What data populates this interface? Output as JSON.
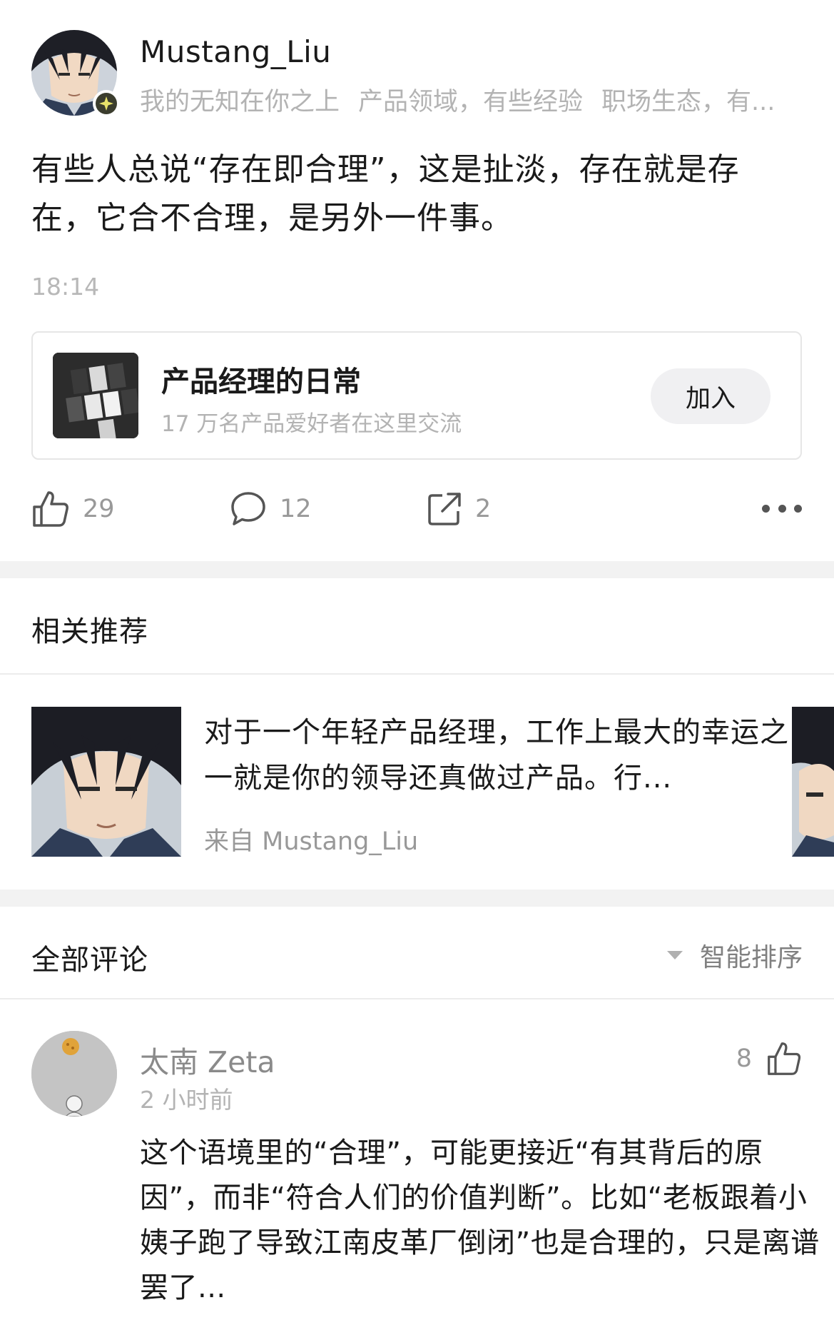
{
  "post": {
    "author": "Mustang_Liu",
    "tags": [
      "我的无知在你之上",
      "产品领域，有些经验",
      "职场生态，有..."
    ],
    "text": "有些人总说“存在即合理”，这是扯淡，存在就是存在，它合不合理，是另外一件事。",
    "time": "18:14"
  },
  "group": {
    "title": "产品经理的日常",
    "subtitle": "17 万名产品爱好者在这里交流",
    "join_label": "加入"
  },
  "actions": {
    "likes": "29",
    "comments": "12",
    "shares": "2"
  },
  "related": {
    "title": "相关推荐",
    "items": [
      {
        "title": "对于一个年轻产品经理，工作上最大的幸运之一就是你的领导还真做过产品。行...",
        "from": "来自 Mustang_Liu"
      }
    ]
  },
  "comments_section": {
    "title": "全部评论",
    "sort_label": "智能排序",
    "items": [
      {
        "author": "太南 Zeta",
        "time": "2 小时前",
        "likes": "8",
        "text": "这个语境里的“合理”，可能更接近“有其背后的原因”，而非“符合人们的价值判断”。比如“老板跟着小姨子跑了导致江南皮革厂倒闭”也是合理的，只是离谱罢了..."
      }
    ]
  },
  "icons": {
    "like": "thumbs-up-icon",
    "comment": "comment-bubble-icon",
    "share": "share-icon",
    "more": "more-dots-icon",
    "sort": "caret-down-icon",
    "badge": "verified-badge-icon"
  }
}
